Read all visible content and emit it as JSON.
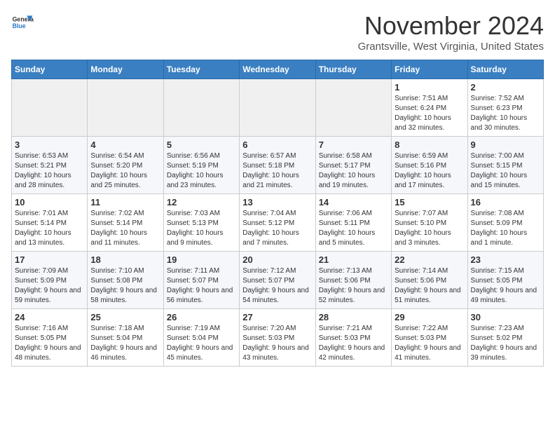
{
  "header": {
    "logo_line1": "General",
    "logo_line2": "Blue",
    "month": "November 2024",
    "location": "Grantsville, West Virginia, United States"
  },
  "weekdays": [
    "Sunday",
    "Monday",
    "Tuesday",
    "Wednesday",
    "Thursday",
    "Friday",
    "Saturday"
  ],
  "weeks": [
    [
      {
        "day": "",
        "info": ""
      },
      {
        "day": "",
        "info": ""
      },
      {
        "day": "",
        "info": ""
      },
      {
        "day": "",
        "info": ""
      },
      {
        "day": "",
        "info": ""
      },
      {
        "day": "1",
        "info": "Sunrise: 7:51 AM\nSunset: 6:24 PM\nDaylight: 10 hours and 32 minutes."
      },
      {
        "day": "2",
        "info": "Sunrise: 7:52 AM\nSunset: 6:23 PM\nDaylight: 10 hours and 30 minutes."
      }
    ],
    [
      {
        "day": "3",
        "info": "Sunrise: 6:53 AM\nSunset: 5:21 PM\nDaylight: 10 hours and 28 minutes."
      },
      {
        "day": "4",
        "info": "Sunrise: 6:54 AM\nSunset: 5:20 PM\nDaylight: 10 hours and 25 minutes."
      },
      {
        "day": "5",
        "info": "Sunrise: 6:56 AM\nSunset: 5:19 PM\nDaylight: 10 hours and 23 minutes."
      },
      {
        "day": "6",
        "info": "Sunrise: 6:57 AM\nSunset: 5:18 PM\nDaylight: 10 hours and 21 minutes."
      },
      {
        "day": "7",
        "info": "Sunrise: 6:58 AM\nSunset: 5:17 PM\nDaylight: 10 hours and 19 minutes."
      },
      {
        "day": "8",
        "info": "Sunrise: 6:59 AM\nSunset: 5:16 PM\nDaylight: 10 hours and 17 minutes."
      },
      {
        "day": "9",
        "info": "Sunrise: 7:00 AM\nSunset: 5:15 PM\nDaylight: 10 hours and 15 minutes."
      }
    ],
    [
      {
        "day": "10",
        "info": "Sunrise: 7:01 AM\nSunset: 5:14 PM\nDaylight: 10 hours and 13 minutes."
      },
      {
        "day": "11",
        "info": "Sunrise: 7:02 AM\nSunset: 5:14 PM\nDaylight: 10 hours and 11 minutes."
      },
      {
        "day": "12",
        "info": "Sunrise: 7:03 AM\nSunset: 5:13 PM\nDaylight: 10 hours and 9 minutes."
      },
      {
        "day": "13",
        "info": "Sunrise: 7:04 AM\nSunset: 5:12 PM\nDaylight: 10 hours and 7 minutes."
      },
      {
        "day": "14",
        "info": "Sunrise: 7:06 AM\nSunset: 5:11 PM\nDaylight: 10 hours and 5 minutes."
      },
      {
        "day": "15",
        "info": "Sunrise: 7:07 AM\nSunset: 5:10 PM\nDaylight: 10 hours and 3 minutes."
      },
      {
        "day": "16",
        "info": "Sunrise: 7:08 AM\nSunset: 5:09 PM\nDaylight: 10 hours and 1 minute."
      }
    ],
    [
      {
        "day": "17",
        "info": "Sunrise: 7:09 AM\nSunset: 5:09 PM\nDaylight: 9 hours and 59 minutes."
      },
      {
        "day": "18",
        "info": "Sunrise: 7:10 AM\nSunset: 5:08 PM\nDaylight: 9 hours and 58 minutes."
      },
      {
        "day": "19",
        "info": "Sunrise: 7:11 AM\nSunset: 5:07 PM\nDaylight: 9 hours and 56 minutes."
      },
      {
        "day": "20",
        "info": "Sunrise: 7:12 AM\nSunset: 5:07 PM\nDaylight: 9 hours and 54 minutes."
      },
      {
        "day": "21",
        "info": "Sunrise: 7:13 AM\nSunset: 5:06 PM\nDaylight: 9 hours and 52 minutes."
      },
      {
        "day": "22",
        "info": "Sunrise: 7:14 AM\nSunset: 5:06 PM\nDaylight: 9 hours and 51 minutes."
      },
      {
        "day": "23",
        "info": "Sunrise: 7:15 AM\nSunset: 5:05 PM\nDaylight: 9 hours and 49 minutes."
      }
    ],
    [
      {
        "day": "24",
        "info": "Sunrise: 7:16 AM\nSunset: 5:05 PM\nDaylight: 9 hours and 48 minutes."
      },
      {
        "day": "25",
        "info": "Sunrise: 7:18 AM\nSunset: 5:04 PM\nDaylight: 9 hours and 46 minutes."
      },
      {
        "day": "26",
        "info": "Sunrise: 7:19 AM\nSunset: 5:04 PM\nDaylight: 9 hours and 45 minutes."
      },
      {
        "day": "27",
        "info": "Sunrise: 7:20 AM\nSunset: 5:03 PM\nDaylight: 9 hours and 43 minutes."
      },
      {
        "day": "28",
        "info": "Sunrise: 7:21 AM\nSunset: 5:03 PM\nDaylight: 9 hours and 42 minutes."
      },
      {
        "day": "29",
        "info": "Sunrise: 7:22 AM\nSunset: 5:03 PM\nDaylight: 9 hours and 41 minutes."
      },
      {
        "day": "30",
        "info": "Sunrise: 7:23 AM\nSunset: 5:02 PM\nDaylight: 9 hours and 39 minutes."
      }
    ]
  ]
}
